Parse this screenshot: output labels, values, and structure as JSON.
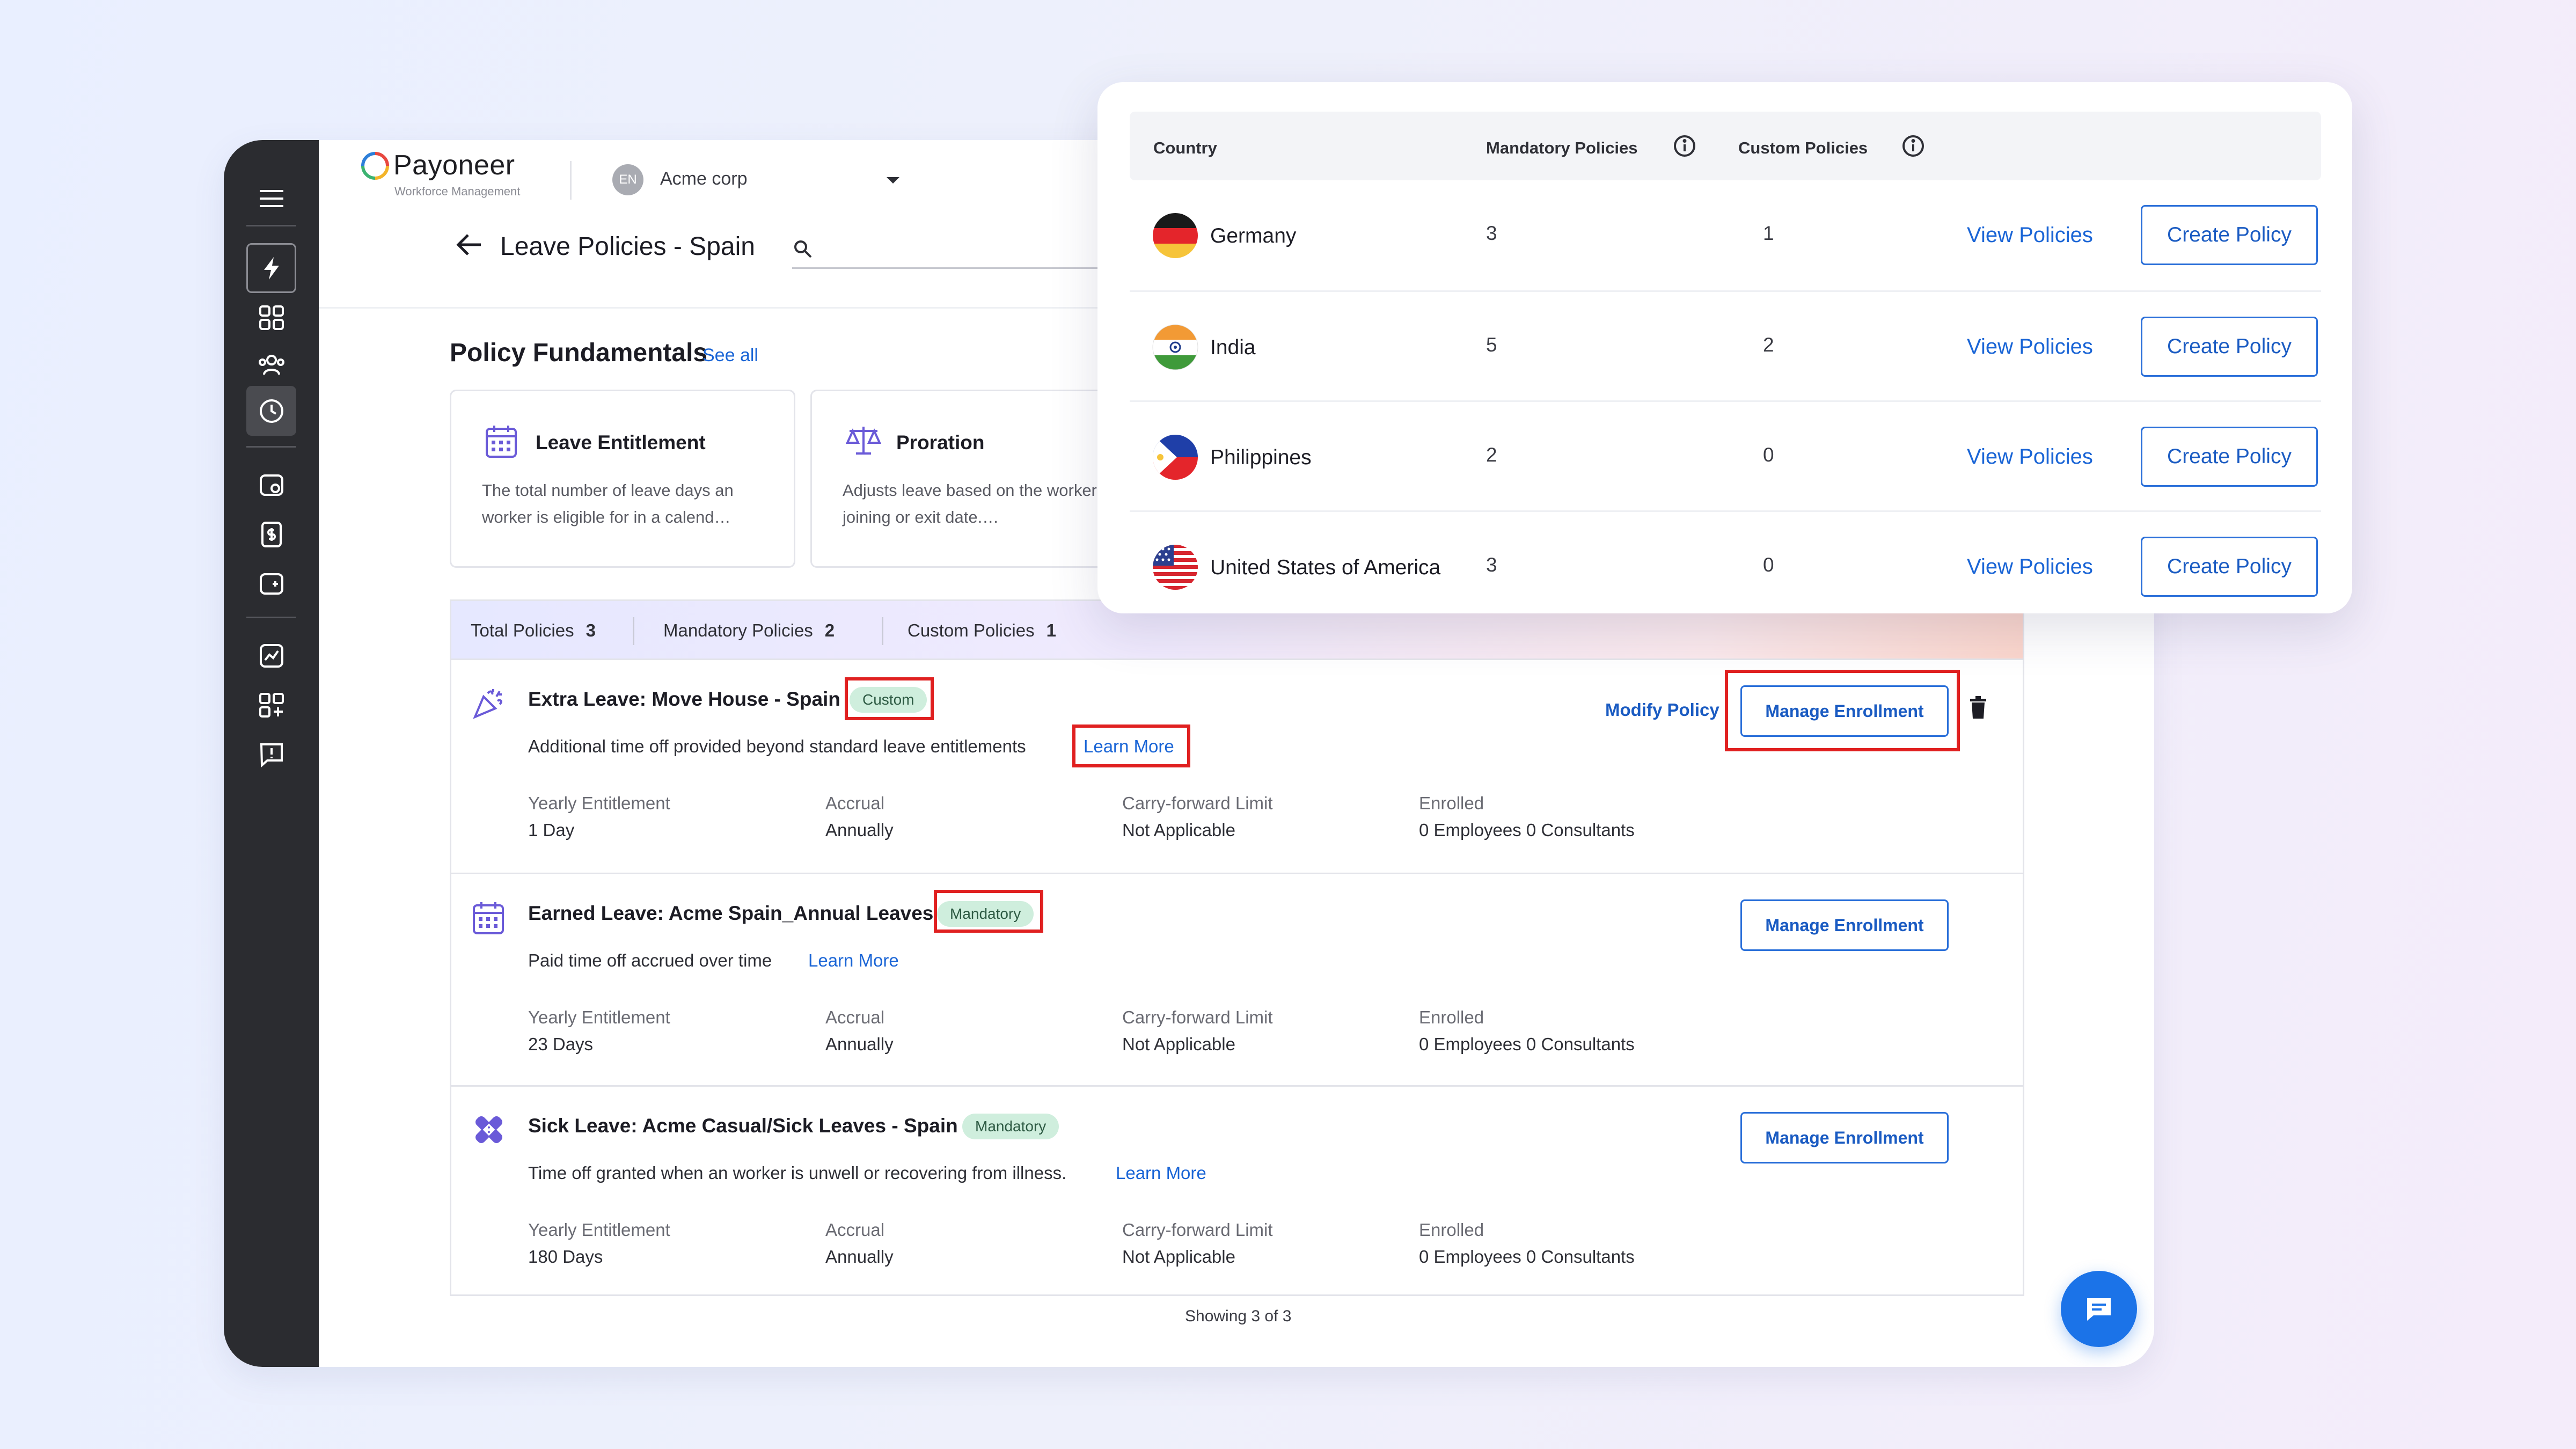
{
  "brand": {
    "name": "Payoneer",
    "subtitle": "Workforce Management"
  },
  "org": {
    "initials": "EN",
    "name": "Acme corp"
  },
  "page": {
    "title": "Leave Policies - Spain",
    "search_placeholder": ""
  },
  "fundamentals": {
    "title": "Policy Fundamentals",
    "see_all": "See all",
    "cards": [
      {
        "title": "Leave Entitlement",
        "desc": "The total number of leave days an worker is eligible for in a calend…",
        "icon": "calendar-icon"
      },
      {
        "title": "Proration",
        "desc": "Adjusts leave based on the worker's joining or exit date.…",
        "icon": "scales-icon"
      }
    ]
  },
  "summary": {
    "total_label": "Total Policies",
    "total_value": "3",
    "mandatory_label": "Mandatory Policies",
    "mandatory_value": "2",
    "custom_label": "Custom Policies",
    "custom_value": "1"
  },
  "meta_labels": {
    "yearly": "Yearly Entitlement",
    "accrual": "Accrual",
    "carry": "Carry-forward Limit",
    "enrolled": "Enrolled"
  },
  "policies": [
    {
      "title": "Extra Leave: Move House - Spain",
      "tag": "Custom",
      "desc": "Additional time off provided beyond standard leave entitlements",
      "learn": "Learn More",
      "yearly": "1 Day",
      "accrual": "Annually",
      "carry": "Not Applicable",
      "enrolled": "0 Employees 0 Consultants",
      "modify": "Modify Policy",
      "button": "Manage Enrollment",
      "icon": "party-popper-icon"
    },
    {
      "title": "Earned Leave: Acme Spain_Annual Leaves",
      "tag": "Mandatory",
      "desc": "Paid time off accrued over time",
      "learn": "Learn More",
      "yearly": "23 Days",
      "accrual": "Annually",
      "carry": "Not Applicable",
      "enrolled": "0 Employees 0 Consultants",
      "button": "Manage Enrollment",
      "icon": "calendar-icon"
    },
    {
      "title": "Sick Leave: Acme Casual/Sick Leaves - Spain",
      "tag": "Mandatory",
      "desc": "Time off granted when an worker is unwell or recovering from illness.",
      "learn": "Learn More",
      "yearly": "180 Days",
      "accrual": "Annually",
      "carry": "Not Applicable",
      "enrolled": "0 Employees 0 Consultants",
      "button": "Manage Enrollment",
      "icon": "bandage-icon"
    }
  ],
  "showing": "Showing 3 of 3",
  "overlay": {
    "headers": {
      "country": "Country",
      "mandatory": "Mandatory Policies",
      "custom": "Custom Policies"
    },
    "rows": [
      {
        "country": "Germany",
        "mandatory": "3",
        "custom": "1",
        "view": "View Policies",
        "create": "Create Policy",
        "flag": "germany-flag-icon"
      },
      {
        "country": "India",
        "mandatory": "5",
        "custom": "2",
        "view": "View Policies",
        "create": "Create Policy",
        "flag": "india-flag-icon"
      },
      {
        "country": "Philippines",
        "mandatory": "2",
        "custom": "0",
        "view": "View Policies",
        "create": "Create Policy",
        "flag": "philippines-flag-icon"
      },
      {
        "country": "United States of America",
        "mandatory": "3",
        "custom": "0",
        "view": "View Policies",
        "create": "Create Policy",
        "flag": "usa-flag-icon"
      }
    ]
  },
  "colors": {
    "accent": "#1a65d6",
    "sidebar": "#2b2c30",
    "tag_bg": "#cfeedd",
    "highlight": "#e02020"
  }
}
